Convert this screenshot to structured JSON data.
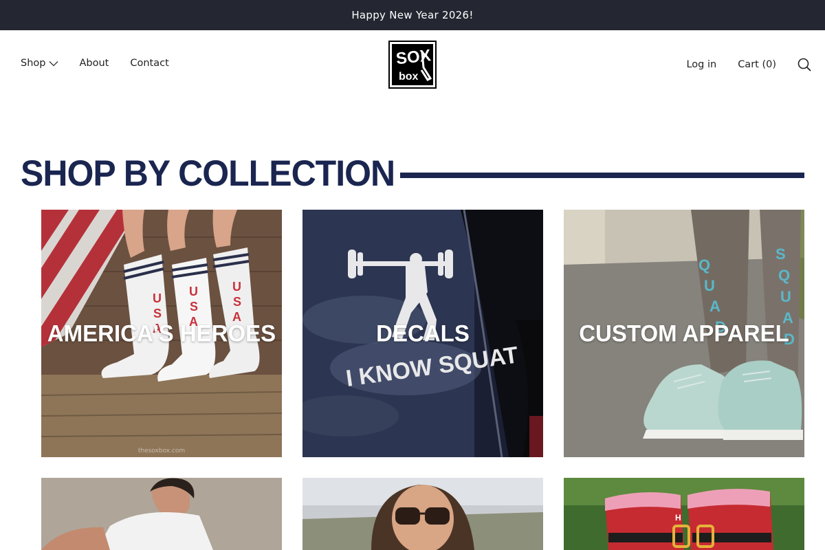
{
  "announcement": "Happy New Year 2026!",
  "nav": {
    "shop": "Shop",
    "about": "About",
    "contact": "Contact",
    "login": "Log in",
    "cart": "Cart (0)",
    "search_icon": "search-icon",
    "shop_chevron_icon": "chevron-down-icon"
  },
  "logo": {
    "line1": "SOX",
    "line2": "box"
  },
  "section": {
    "title": "SHOP BY COLLECTION"
  },
  "collections": [
    {
      "label": "AMERICA'S HEROES",
      "watermark": "thesoxbox.com"
    },
    {
      "label": "DECALS",
      "decal_text": "I KNOW SQUAT"
    },
    {
      "label": "CUSTOM APPAREL",
      "sock_text_left": "QUAD",
      "sock_text_right": "SQUAD"
    },
    {
      "label": ""
    },
    {
      "label": ""
    },
    {
      "label": ""
    }
  ],
  "colors": {
    "announcement_bg": "#242731",
    "brand_navy": "#1a2550",
    "usa_red": "#c8323c",
    "sock_teal": "#4fb6c8"
  }
}
